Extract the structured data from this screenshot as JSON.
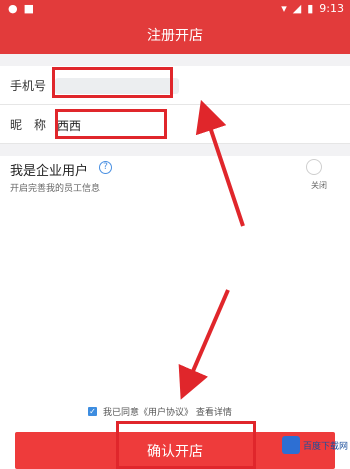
{
  "status_bar": {
    "time": "9:13"
  },
  "header": {
    "title": "注册开店"
  },
  "form": {
    "phone_label": "手机号",
    "phone_value": "",
    "nickname_label": "昵　称",
    "nickname_value": "西西"
  },
  "enterprise": {
    "title": "我是企业用户",
    "desc": "开启完善我的员工信息",
    "toggle_label": "关闭",
    "toggle_on": false
  },
  "agreement": {
    "text": "我已同意《用户协议》 查看详情",
    "checked": true
  },
  "confirm_label": "确认开店",
  "colors": {
    "primary": "#e23b3b",
    "annotation": "#e0262b"
  },
  "watermark": {
    "text": "百度下载网"
  }
}
